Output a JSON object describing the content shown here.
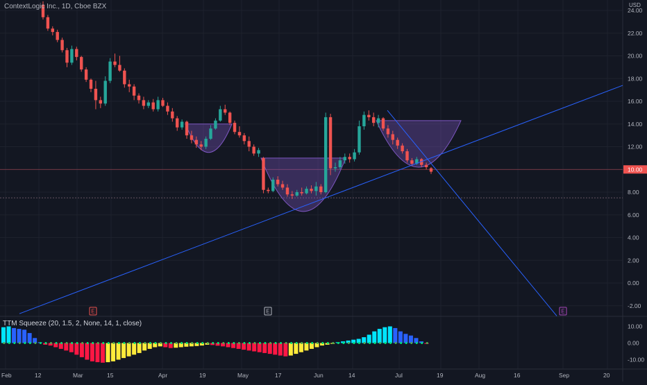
{
  "header": {
    "title": "ContextLogic Inc., 1D, Cboe BZX",
    "currency": "USD",
    "price_badge": "10.00"
  },
  "indicator": {
    "label": "TTM Squeeze (20, 1.5, 2, None, 14, 1, close)"
  },
  "colors": {
    "background": "#131722",
    "up": "#26a69a",
    "down": "#ef5350",
    "trendline": "#2962ff",
    "pattern_fill": "#7e57c2",
    "grid": "#1e222d",
    "text": "#b2b5be"
  },
  "earnings_markers": [
    {
      "label": "E",
      "x_label": "Feb 28",
      "color": "#ef5350"
    },
    {
      "label": "E",
      "x_label": "May 12",
      "color": "#b2b5be"
    },
    {
      "label": "E",
      "x_label": "Aug 31",
      "color": "#ab47bc"
    }
  ],
  "chart_data": [
    {
      "type": "candlestick",
      "title": "ContextLogic Inc., 1D, Cboe BZX",
      "y_axis": {
        "label": "USD",
        "ticks": [
          "24.00",
          "22.00",
          "20.00",
          "18.00",
          "16.00",
          "14.00",
          "12.00",
          "10.00",
          "8.00",
          "6.00",
          "4.00",
          "2.00",
          "0.00",
          "-2.00"
        ],
        "ylim": [
          -3,
          25
        ]
      },
      "x_axis": {
        "ticks": [
          "Feb",
          "12",
          "Mar",
          "15",
          "Apr",
          "19",
          "May",
          "17",
          "Jun",
          "14",
          "Jul",
          "19",
          "Aug",
          "16",
          "Sep",
          "20"
        ]
      },
      "candles_ohlc": [
        [
          24.5,
          24.8,
          23.2,
          23.4
        ],
        [
          23.4,
          23.6,
          22.2,
          22.4
        ],
        [
          22.4,
          22.6,
          21.8,
          22.1
        ],
        [
          22.1,
          22.3,
          21.2,
          21.4
        ],
        [
          21.4,
          21.6,
          20.3,
          20.5
        ],
        [
          20.5,
          20.7,
          19.0,
          19.4
        ],
        [
          19.4,
          20.9,
          19.2,
          20.6
        ],
        [
          20.6,
          20.8,
          19.6,
          19.9
        ],
        [
          19.9,
          20.0,
          18.6,
          18.8
        ],
        [
          18.8,
          19.0,
          17.7,
          17.9
        ],
        [
          17.9,
          18.0,
          16.8,
          17.1
        ],
        [
          17.1,
          17.8,
          15.3,
          16.1
        ],
        [
          16.1,
          16.4,
          15.4,
          15.8
        ],
        [
          15.8,
          18.2,
          15.6,
          17.8
        ],
        [
          17.8,
          19.8,
          17.6,
          19.5
        ],
        [
          19.5,
          20.2,
          19.0,
          19.2
        ],
        [
          19.2,
          20.0,
          18.6,
          18.7
        ],
        [
          18.7,
          18.9,
          17.2,
          17.5
        ],
        [
          17.5,
          17.9,
          16.8,
          17.3
        ],
        [
          17.3,
          17.5,
          16.1,
          16.5
        ],
        [
          16.5,
          16.7,
          15.8,
          16.1
        ],
        [
          16.1,
          16.4,
          15.3,
          15.6
        ],
        [
          15.6,
          16.1,
          15.4,
          15.9
        ],
        [
          15.9,
          16.2,
          15.1,
          15.3
        ],
        [
          15.3,
          16.4,
          15.1,
          16.1
        ],
        [
          16.1,
          16.3,
          15.5,
          15.6
        ],
        [
          15.6,
          15.9,
          14.8,
          15.1
        ],
        [
          15.1,
          15.4,
          14.2,
          14.5
        ],
        [
          14.5,
          14.7,
          13.4,
          13.7
        ],
        [
          13.7,
          14.4,
          13.5,
          14.2
        ],
        [
          14.2,
          14.3,
          12.7,
          13.0
        ],
        [
          13.0,
          13.4,
          12.3,
          12.6
        ],
        [
          12.6,
          12.9,
          11.9,
          12.2
        ],
        [
          12.2,
          12.5,
          11.7,
          12.0
        ],
        [
          12.0,
          12.9,
          11.8,
          12.7
        ],
        [
          12.7,
          13.9,
          12.6,
          13.6
        ],
        [
          13.6,
          14.5,
          13.5,
          14.3
        ],
        [
          14.3,
          15.6,
          14.2,
          15.3
        ],
        [
          15.3,
          15.7,
          14.8,
          15.0
        ],
        [
          15.0,
          15.1,
          13.9,
          14.1
        ],
        [
          14.1,
          14.3,
          13.1,
          13.3
        ],
        [
          13.3,
          13.8,
          12.8,
          13.0
        ],
        [
          13.0,
          13.2,
          12.2,
          12.5
        ],
        [
          12.5,
          12.9,
          11.6,
          12.0
        ],
        [
          12.0,
          12.2,
          11.2,
          11.4
        ],
        [
          11.4,
          11.9,
          11.1,
          11.7
        ],
        [
          11.0,
          11.1,
          7.9,
          8.2
        ],
        [
          8.2,
          8.4,
          7.9,
          8.1
        ],
        [
          8.1,
          9.3,
          8.0,
          9.1
        ],
        [
          9.1,
          9.4,
          8.5,
          8.7
        ],
        [
          8.7,
          9.0,
          8.2,
          8.4
        ],
        [
          8.4,
          8.7,
          7.6,
          7.8
        ],
        [
          7.8,
          8.1,
          7.4,
          7.7
        ],
        [
          7.7,
          8.2,
          7.6,
          8.0
        ],
        [
          8.0,
          8.4,
          7.7,
          7.9
        ],
        [
          7.9,
          8.5,
          7.8,
          8.3
        ],
        [
          8.3,
          8.6,
          7.9,
          8.1
        ],
        [
          8.1,
          8.9,
          7.7,
          8.5
        ],
        [
          8.5,
          8.7,
          7.8,
          8.0
        ],
        [
          8.0,
          15.0,
          7.9,
          14.6
        ],
        [
          14.6,
          14.9,
          9.5,
          10.1
        ],
        [
          10.1,
          10.6,
          9.8,
          10.2
        ],
        [
          10.2,
          11.1,
          10.0,
          10.8
        ],
        [
          10.8,
          11.4,
          10.5,
          11.1
        ],
        [
          11.1,
          11.4,
          10.6,
          10.9
        ],
        [
          10.9,
          11.8,
          10.7,
          11.5
        ],
        [
          11.5,
          14.3,
          11.3,
          13.8
        ],
        [
          13.8,
          15.1,
          13.5,
          14.8
        ],
        [
          14.8,
          15.2,
          14.3,
          14.6
        ],
        [
          14.6,
          15.0,
          13.8,
          14.1
        ],
        [
          14.1,
          14.8,
          13.7,
          14.5
        ],
        [
          14.5,
          14.6,
          13.4,
          13.6
        ],
        [
          13.6,
          13.9,
          12.8,
          13.1
        ],
        [
          13.1,
          13.4,
          12.2,
          12.6
        ],
        [
          12.6,
          12.8,
          11.8,
          12.1
        ],
        [
          12.1,
          12.3,
          11.4,
          11.6
        ],
        [
          11.6,
          11.8,
          10.6,
          10.8
        ],
        [
          10.8,
          11.0,
          10.3,
          10.5
        ],
        [
          10.5,
          11.1,
          10.4,
          10.9
        ],
        [
          10.9,
          11.0,
          10.2,
          10.4
        ],
        [
          10.4,
          10.6,
          10.0,
          10.2
        ],
        [
          10.1,
          10.2,
          9.6,
          9.8
        ]
      ],
      "trendlines": [
        {
          "from": [
            "Feb",
            -2.7
          ],
          "to": [
            "Sep end",
            17.4
          ]
        },
        {
          "from": [
            "Jun 29",
            15.2
          ],
          "to": [
            "Sep 1",
            -2.9
          ]
        }
      ],
      "horizontal_levels": [
        10.0,
        7.5
      ],
      "cup_patterns": [
        {
          "from": [
            "Apr 12",
            14.0
          ],
          "to": [
            "May 2",
            14.0
          ],
          "low": 11.5
        },
        {
          "from": [
            "May 13",
            11.0
          ],
          "to": [
            "Jun 12",
            11.0
          ],
          "low": 6.3
        },
        {
          "from": [
            "Jun 26",
            14.3
          ],
          "to": [
            "Jul 29",
            14.3
          ],
          "low": 10.2
        }
      ],
      "grid": true
    },
    {
      "type": "bar",
      "title": "TTM Squeeze (20, 1.5, 2, None, 14, 1, close)",
      "y_axis": {
        "ticks": [
          "10.00",
          "0.00",
          "-10.00"
        ],
        "ylim": [
          -12,
          12
        ]
      },
      "momentum_values": [
        9.5,
        10.0,
        9.0,
        8.5,
        8.0,
        6.0,
        3.0,
        0.5,
        -1.0,
        -1.5,
        -2.5,
        -3.5,
        -4.5,
        -5.5,
        -7.0,
        -8.5,
        -10.0,
        -11.0,
        -11.5,
        -11.8,
        -11.5,
        -11.0,
        -10.0,
        -9.0,
        -8.0,
        -7.0,
        -6.0,
        -4.5,
        -3.5,
        -2.5,
        -2.0,
        -2.5,
        -3.0,
        -2.8,
        -2.5,
        -2.2,
        -2.0,
        -1.8,
        -1.5,
        -1.0,
        -1.2,
        -1.6,
        -2.0,
        -2.5,
        -3.0,
        -3.5,
        -4.0,
        -4.5,
        -5.0,
        -5.5,
        -6.0,
        -6.5,
        -7.0,
        -7.5,
        -8.0,
        -7.5,
        -6.5,
        -5.5,
        -4.5,
        -3.5,
        -2.5,
        -1.5,
        -1.0,
        -0.5,
        0.5,
        1.0,
        1.5,
        2.0,
        2.5,
        3.5,
        5.0,
        7.0,
        8.5,
        9.5,
        10.0,
        9.0,
        7.0,
        5.5,
        4.5,
        3.0,
        1.0,
        -0.5
      ],
      "colors": {
        "rising_up": "#00e5ff",
        "falling_up": "#2962ff",
        "falling_down": "#ff1744",
        "rising_down": "#ffeb3b"
      }
    }
  ]
}
